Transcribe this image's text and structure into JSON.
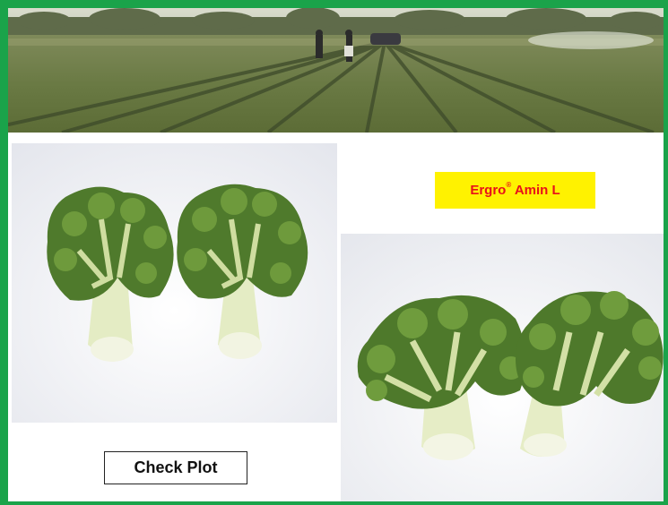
{
  "labels": {
    "treatment_brand": "Ergro",
    "treatment_mark": "®",
    "treatment_rest": " Amin L",
    "control": "Check Plot"
  },
  "colors": {
    "frame": "#1aa34a",
    "treatment_label_bg": "#fff200",
    "treatment_label_text": "#e8101a"
  }
}
